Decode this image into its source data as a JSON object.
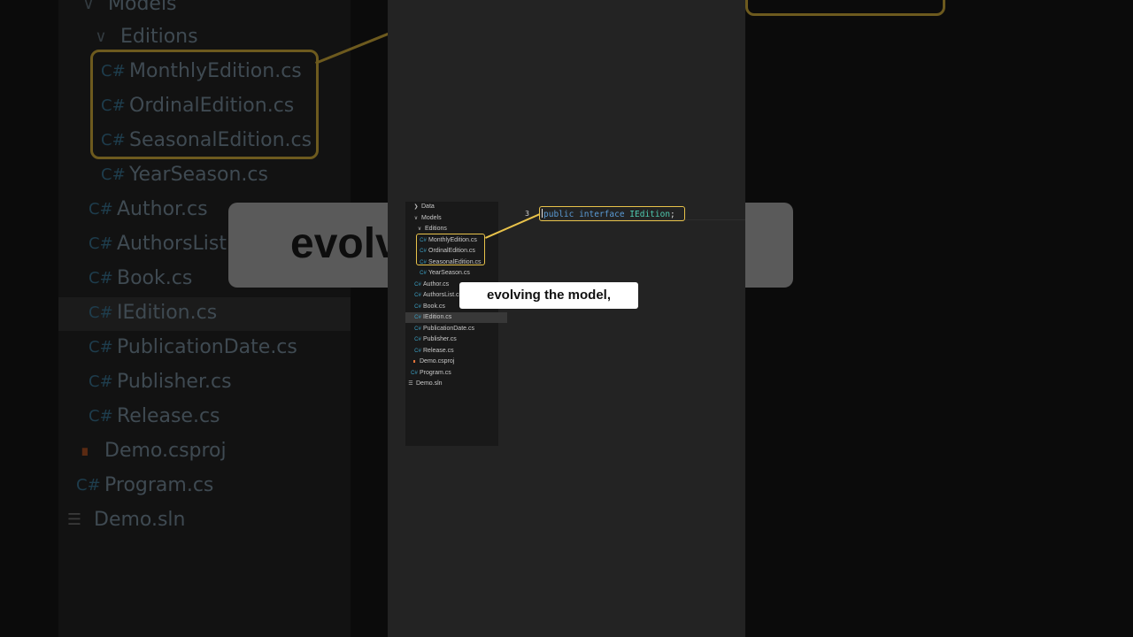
{
  "explorer": {
    "items": [
      {
        "label": "Data",
        "icon": "chevron-right-icon",
        "kind": "folder",
        "depth": 0
      },
      {
        "label": "Models",
        "icon": "chevron-down-icon",
        "kind": "folder",
        "depth": 0
      },
      {
        "label": "Editions",
        "icon": "chevron-down-icon",
        "kind": "folder",
        "depth": 1
      },
      {
        "label": "MonthlyEdition.cs",
        "icon": "csharp-file-icon",
        "kind": "file",
        "depth": 2
      },
      {
        "label": "OrdinalEdition.cs",
        "icon": "csharp-file-icon",
        "kind": "file",
        "depth": 2
      },
      {
        "label": "SeasonalEdition.cs",
        "icon": "csharp-file-icon",
        "kind": "file",
        "depth": 2
      },
      {
        "label": "YearSeason.cs",
        "icon": "csharp-file-icon",
        "kind": "file",
        "depth": 2
      },
      {
        "label": "Author.cs",
        "icon": "csharp-file-icon",
        "kind": "file",
        "depth": 1
      },
      {
        "label": "AuthorsList.cs",
        "icon": "csharp-file-icon",
        "kind": "file",
        "depth": 1
      },
      {
        "label": "Book.cs",
        "icon": "csharp-file-icon",
        "kind": "file",
        "depth": 1
      },
      {
        "label": "IEdition.cs",
        "icon": "csharp-file-icon",
        "kind": "file",
        "depth": 1,
        "selected": true
      },
      {
        "label": "PublicationDate.cs",
        "icon": "csharp-file-icon",
        "kind": "file",
        "depth": 1
      },
      {
        "label": "Publisher.cs",
        "icon": "csharp-file-icon",
        "kind": "file",
        "depth": 1
      },
      {
        "label": "Release.cs",
        "icon": "csharp-file-icon",
        "kind": "file",
        "depth": 1
      },
      {
        "label": "Demo.csproj",
        "icon": "rss-icon",
        "kind": "project",
        "depth": 0
      },
      {
        "label": "Program.cs",
        "icon": "csharp-file-icon",
        "kind": "file",
        "depth": 0
      },
      {
        "label": "Demo.sln",
        "icon": "solution-icon",
        "kind": "solution",
        "depth": -1
      }
    ],
    "highlight_group": [
      "MonthlyEdition.cs",
      "OrdinalEdition.cs",
      "SeasonalEdition.cs"
    ]
  },
  "editor": {
    "line_number": "3",
    "code": {
      "kw1": "public",
      "kw2": "interface",
      "type_name": "IEdition",
      "punct": ";"
    }
  },
  "caption": {
    "text": "evolving the model,",
    "bg_text": "evolv"
  },
  "background": {
    "items": [
      {
        "label": "Models",
        "icon": "chevron-down-icon"
      },
      {
        "label": "Editions",
        "icon": "chevron-down-icon"
      },
      {
        "label": "MonthlyEdition.cs",
        "icon": "csharp-file-icon"
      },
      {
        "label": "OrdinalEdition.cs",
        "icon": "csharp-file-icon"
      },
      {
        "label": "SeasonalEdition.cs",
        "icon": "csharp-file-icon"
      },
      {
        "label": "YearSeason.cs",
        "icon": "csharp-file-icon"
      },
      {
        "label": "Author.cs",
        "icon": "csharp-file-icon"
      },
      {
        "label": "AuthorsList.cs",
        "icon": "csharp-file-icon"
      },
      {
        "label": "Book.cs",
        "icon": "csharp-file-icon"
      },
      {
        "label": "IEdition.cs",
        "icon": "csharp-file-icon"
      },
      {
        "label": "PublicationDate.cs",
        "icon": "csharp-file-icon"
      },
      {
        "label": "Publisher.cs",
        "icon": "csharp-file-icon"
      },
      {
        "label": "Release.cs",
        "icon": "csharp-file-icon"
      },
      {
        "label": "Demo.csproj",
        "icon": "rss-icon"
      },
      {
        "label": "Program.cs",
        "icon": "csharp-file-icon"
      },
      {
        "label": "Demo.sln",
        "icon": "solution-icon"
      }
    ]
  },
  "colors": {
    "highlight": "#e8c24a",
    "csharp_icon": "#3ba0c4",
    "project_icon": "#e2733a",
    "keyword": "#5a9bd6",
    "type": "#4ec9b0"
  }
}
